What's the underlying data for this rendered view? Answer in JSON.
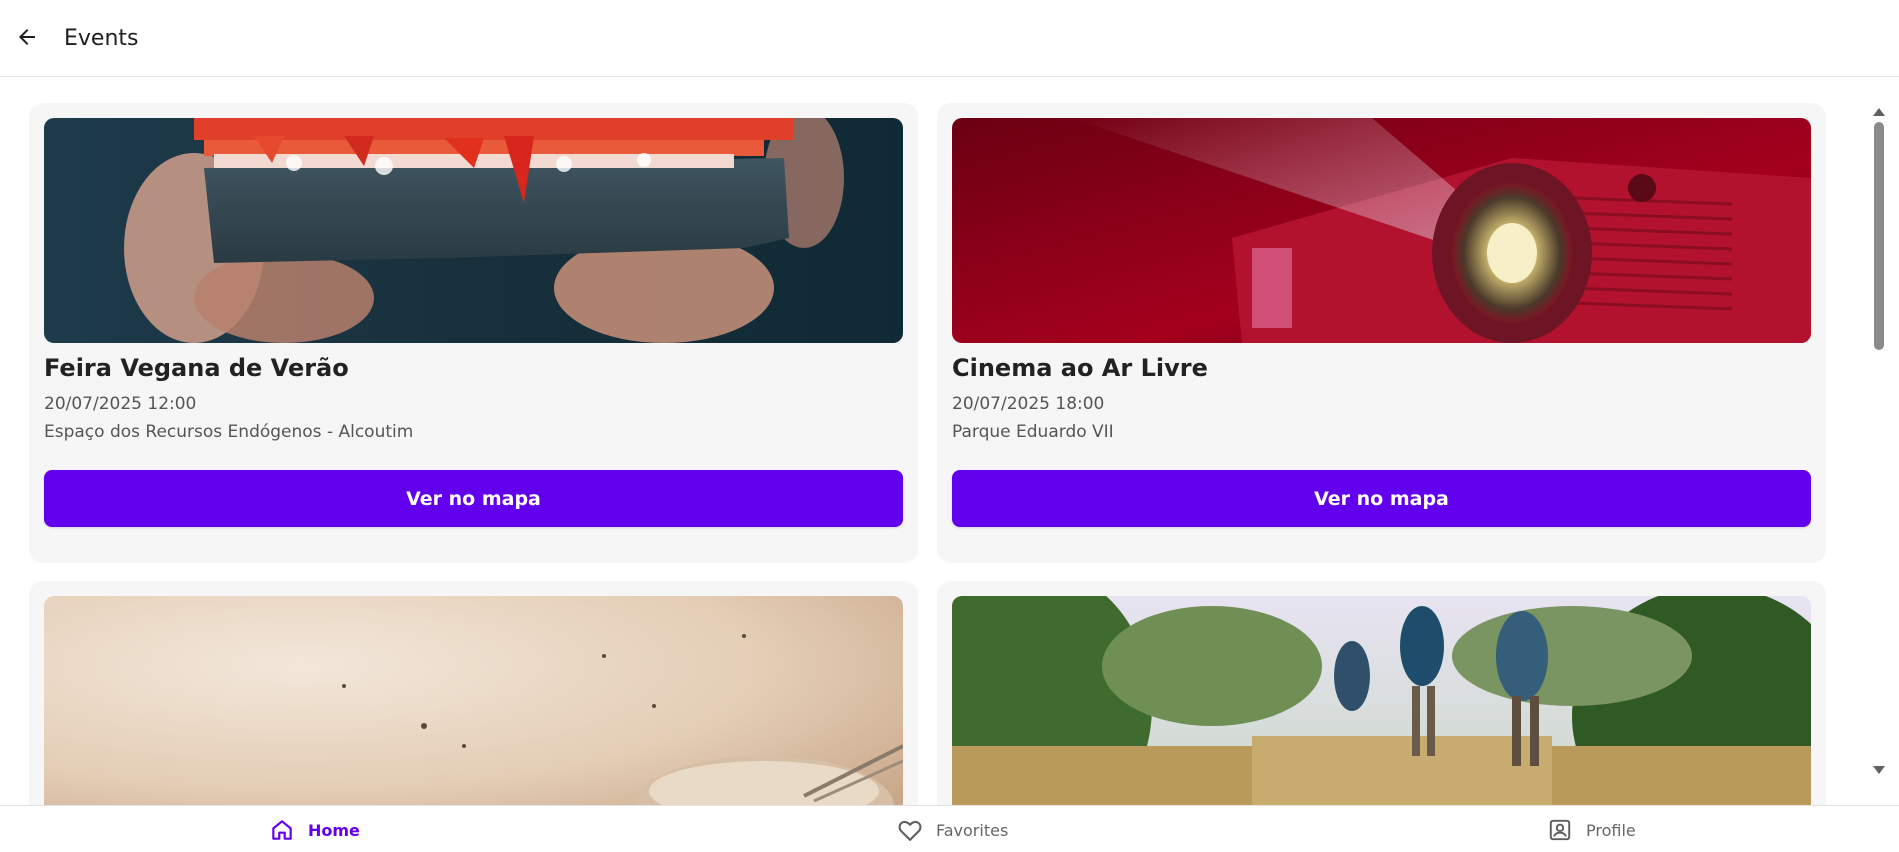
{
  "header": {
    "title": "Events",
    "back_icon": "arrow-left-icon"
  },
  "events": [
    {
      "title": "Feira Vegana de Verão",
      "datetime": "20/07/2025 12:00",
      "location": "Espaço dos Recursos Endógenos - Alcoutim",
      "button_label": "Ver no mapa"
    },
    {
      "title": "Cinema ao Ar Livre",
      "datetime": "20/07/2025 18:00",
      "location": "Parque Eduardo VII",
      "button_label": "Ver no mapa"
    }
  ],
  "bottom_nav": {
    "items": [
      {
        "label": "Home",
        "icon": "home-icon",
        "active": true
      },
      {
        "label": "Favorites",
        "icon": "heart-icon",
        "active": false
      },
      {
        "label": "Profile",
        "icon": "profile-icon",
        "active": false
      }
    ]
  },
  "colors": {
    "accent": "#6200ee",
    "card_background": "#f6f6f6",
    "text_primary": "#222222",
    "text_secondary": "#555555"
  }
}
